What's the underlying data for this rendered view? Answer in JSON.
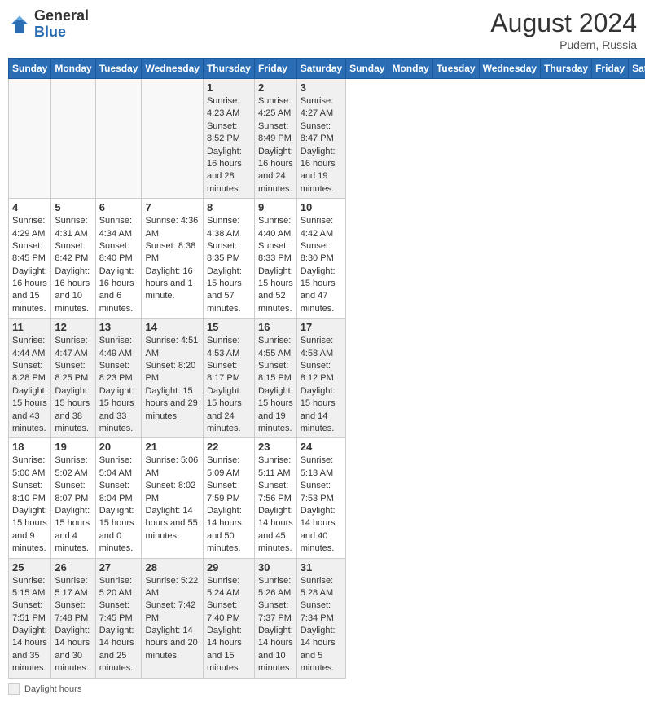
{
  "header": {
    "title": "August 2024",
    "location": "Pudem, Russia",
    "logo_general": "General",
    "logo_blue": "Blue"
  },
  "columns": [
    "Sunday",
    "Monday",
    "Tuesday",
    "Wednesday",
    "Thursday",
    "Friday",
    "Saturday"
  ],
  "weeks": [
    [
      {
        "day": "",
        "info": "",
        "empty": true
      },
      {
        "day": "",
        "info": "",
        "empty": true
      },
      {
        "day": "",
        "info": "",
        "empty": true
      },
      {
        "day": "",
        "info": "",
        "empty": true
      },
      {
        "day": "1",
        "info": "Sunrise: 4:23 AM\nSunset: 8:52 PM\nDaylight: 16 hours and 28 minutes.",
        "empty": false
      },
      {
        "day": "2",
        "info": "Sunrise: 4:25 AM\nSunset: 8:49 PM\nDaylight: 16 hours and 24 minutes.",
        "empty": false
      },
      {
        "day": "3",
        "info": "Sunrise: 4:27 AM\nSunset: 8:47 PM\nDaylight: 16 hours and 19 minutes.",
        "empty": false
      }
    ],
    [
      {
        "day": "4",
        "info": "Sunrise: 4:29 AM\nSunset: 8:45 PM\nDaylight: 16 hours and 15 minutes.",
        "empty": false
      },
      {
        "day": "5",
        "info": "Sunrise: 4:31 AM\nSunset: 8:42 PM\nDaylight: 16 hours and 10 minutes.",
        "empty": false
      },
      {
        "day": "6",
        "info": "Sunrise: 4:34 AM\nSunset: 8:40 PM\nDaylight: 16 hours and 6 minutes.",
        "empty": false
      },
      {
        "day": "7",
        "info": "Sunrise: 4:36 AM\nSunset: 8:38 PM\nDaylight: 16 hours and 1 minute.",
        "empty": false
      },
      {
        "day": "8",
        "info": "Sunrise: 4:38 AM\nSunset: 8:35 PM\nDaylight: 15 hours and 57 minutes.",
        "empty": false
      },
      {
        "day": "9",
        "info": "Sunrise: 4:40 AM\nSunset: 8:33 PM\nDaylight: 15 hours and 52 minutes.",
        "empty": false
      },
      {
        "day": "10",
        "info": "Sunrise: 4:42 AM\nSunset: 8:30 PM\nDaylight: 15 hours and 47 minutes.",
        "empty": false
      }
    ],
    [
      {
        "day": "11",
        "info": "Sunrise: 4:44 AM\nSunset: 8:28 PM\nDaylight: 15 hours and 43 minutes.",
        "empty": false
      },
      {
        "day": "12",
        "info": "Sunrise: 4:47 AM\nSunset: 8:25 PM\nDaylight: 15 hours and 38 minutes.",
        "empty": false
      },
      {
        "day": "13",
        "info": "Sunrise: 4:49 AM\nSunset: 8:23 PM\nDaylight: 15 hours and 33 minutes.",
        "empty": false
      },
      {
        "day": "14",
        "info": "Sunrise: 4:51 AM\nSunset: 8:20 PM\nDaylight: 15 hours and 29 minutes.",
        "empty": false
      },
      {
        "day": "15",
        "info": "Sunrise: 4:53 AM\nSunset: 8:17 PM\nDaylight: 15 hours and 24 minutes.",
        "empty": false
      },
      {
        "day": "16",
        "info": "Sunrise: 4:55 AM\nSunset: 8:15 PM\nDaylight: 15 hours and 19 minutes.",
        "empty": false
      },
      {
        "day": "17",
        "info": "Sunrise: 4:58 AM\nSunset: 8:12 PM\nDaylight: 15 hours and 14 minutes.",
        "empty": false
      }
    ],
    [
      {
        "day": "18",
        "info": "Sunrise: 5:00 AM\nSunset: 8:10 PM\nDaylight: 15 hours and 9 minutes.",
        "empty": false
      },
      {
        "day": "19",
        "info": "Sunrise: 5:02 AM\nSunset: 8:07 PM\nDaylight: 15 hours and 4 minutes.",
        "empty": false
      },
      {
        "day": "20",
        "info": "Sunrise: 5:04 AM\nSunset: 8:04 PM\nDaylight: 15 hours and 0 minutes.",
        "empty": false
      },
      {
        "day": "21",
        "info": "Sunrise: 5:06 AM\nSunset: 8:02 PM\nDaylight: 14 hours and 55 minutes.",
        "empty": false
      },
      {
        "day": "22",
        "info": "Sunrise: 5:09 AM\nSunset: 7:59 PM\nDaylight: 14 hours and 50 minutes.",
        "empty": false
      },
      {
        "day": "23",
        "info": "Sunrise: 5:11 AM\nSunset: 7:56 PM\nDaylight: 14 hours and 45 minutes.",
        "empty": false
      },
      {
        "day": "24",
        "info": "Sunrise: 5:13 AM\nSunset: 7:53 PM\nDaylight: 14 hours and 40 minutes.",
        "empty": false
      }
    ],
    [
      {
        "day": "25",
        "info": "Sunrise: 5:15 AM\nSunset: 7:51 PM\nDaylight: 14 hours and 35 minutes.",
        "empty": false
      },
      {
        "day": "26",
        "info": "Sunrise: 5:17 AM\nSunset: 7:48 PM\nDaylight: 14 hours and 30 minutes.",
        "empty": false
      },
      {
        "day": "27",
        "info": "Sunrise: 5:20 AM\nSunset: 7:45 PM\nDaylight: 14 hours and 25 minutes.",
        "empty": false
      },
      {
        "day": "28",
        "info": "Sunrise: 5:22 AM\nSunset: 7:42 PM\nDaylight: 14 hours and 20 minutes.",
        "empty": false
      },
      {
        "day": "29",
        "info": "Sunrise: 5:24 AM\nSunset: 7:40 PM\nDaylight: 14 hours and 15 minutes.",
        "empty": false
      },
      {
        "day": "30",
        "info": "Sunrise: 5:26 AM\nSunset: 7:37 PM\nDaylight: 14 hours and 10 minutes.",
        "empty": false
      },
      {
        "day": "31",
        "info": "Sunrise: 5:28 AM\nSunset: 7:34 PM\nDaylight: 14 hours and 5 minutes.",
        "empty": false
      }
    ]
  ],
  "footer": {
    "legend_label": "Daylight hours"
  }
}
